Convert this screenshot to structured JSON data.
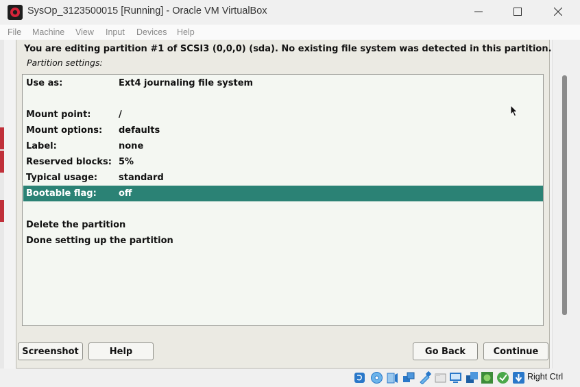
{
  "window": {
    "title": "SysOp_3123500015 [Running] - Oracle VM VirtualBox",
    "controls": [
      "minimize",
      "maximize",
      "close"
    ]
  },
  "menubar": {
    "items": [
      "File",
      "Machine",
      "View",
      "Input",
      "Devices",
      "Help"
    ]
  },
  "installer": {
    "heading": "You are editing partition #1 of SCSI3 (0,0,0) (sda). No existing file system was detected in this partition.",
    "subheading": "Partition settings:",
    "settings": [
      {
        "label": "Use as:",
        "value": "Ext4 journaling file system"
      },
      {
        "label": "Mount point:",
        "value": "/"
      },
      {
        "label": "Mount options:",
        "value": "defaults"
      },
      {
        "label": "Label:",
        "value": "none"
      },
      {
        "label": "Reserved blocks:",
        "value": "5%"
      },
      {
        "label": "Typical usage:",
        "value": "standard"
      },
      {
        "label": "Bootable flag:",
        "value": "off",
        "selected": true
      }
    ],
    "actions": [
      "Delete the partition",
      "Done setting up the partition"
    ],
    "selection_color": "#2b8275",
    "buttons": {
      "screenshot": "Screenshot",
      "help": "Help",
      "go_back": "Go Back",
      "continue": "Continue"
    }
  },
  "statusbar": {
    "icons": [
      "hard-disk-icon",
      "optical-disk-icon",
      "audio-icon",
      "network-icon",
      "usb-icon",
      "shared-folders-icon",
      "display-icon",
      "video-capture-icon",
      "recording-icon",
      "mouse-integration-icon",
      "keyboard-capture-icon"
    ],
    "host_key": "Right Ctrl"
  }
}
